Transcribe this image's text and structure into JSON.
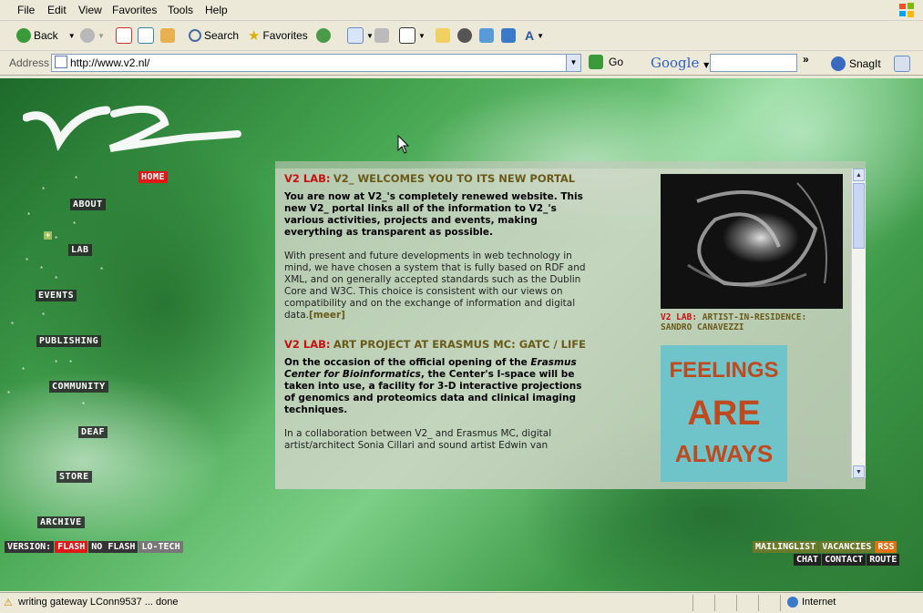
{
  "menu": [
    "File",
    "Edit",
    "View",
    "Favorites",
    "Tools",
    "Help"
  ],
  "toolbar": {
    "back_label": "Back",
    "search_label": "Search",
    "favorites_label": "Favorites"
  },
  "address": {
    "label": "Address",
    "url": "http://www.v2.nl/",
    "go_label": "Go"
  },
  "google": {
    "label": "Google",
    "snagit_label": "SnagIt"
  },
  "page": {
    "nav": [
      "HOME",
      "ABOUT",
      "LAB",
      "EVENTS",
      "PUBLISHING",
      "COMMUNITY",
      "DEAF",
      "STORE",
      "ARCHIVE"
    ],
    "active_nav": "HOME",
    "version": [
      "VERSION:",
      "FLASH",
      "NO FLASH",
      "LO-TECH"
    ],
    "right_links_top": [
      "MAILINGLIST",
      "VACANCIES",
      "RSS"
    ],
    "right_links_bottom": [
      "CHAT",
      "CONTACT",
      "ROUTE"
    ],
    "articles": [
      {
        "prefix": "V2 LAB:",
        "title": "V2_ WELCOMES YOU TO ITS NEW PORTAL",
        "intro": "You are now at V2_'s completely renewed website. This new V2_ portal links all of the information to V2_'s various activities, projects and events, making everything as transparent as possible.",
        "body": "With present and future developments in web technology in mind, we have chosen a system that is fully based on RDF and XML, and on generally accepted standards such as the Dublin Core and W3C. This choice is consistent with our views on compatibility and on the exchange of information and digital data.",
        "more": "[meer]"
      },
      {
        "prefix": "V2 LAB:",
        "title": "ART PROJECT AT ERASMUS MC: GATC / LIFE",
        "intro_a": "On the occasion of the official opening of the ",
        "intro_em": "Erasmus Center for Bioinformatics",
        "intro_b": ", the Center's I-space will be taken into use, a facility for 3-D interactive projections of genomics and proteomics data and clinical imaging techniques.",
        "body": "In a collaboration between V2_ and Erasmus MC, digital artist/architect Sonia Cillari and sound artist Edwin van"
      }
    ],
    "side": {
      "cap_prefix": "V2 LAB:",
      "cap_text": "ARTIST-IN-RESIDENCE: SANDRO CANAVEZZI",
      "poster_words": [
        "FEELINGS",
        "ARE",
        "ALWAYS"
      ]
    }
  },
  "status": {
    "message": "writing gateway LConn9537 ... done",
    "zone": "Internet"
  },
  "colors": {
    "accent_red": "#e01818",
    "title_olive": "#6a5a1a",
    "chrome": "#ece9d8"
  }
}
